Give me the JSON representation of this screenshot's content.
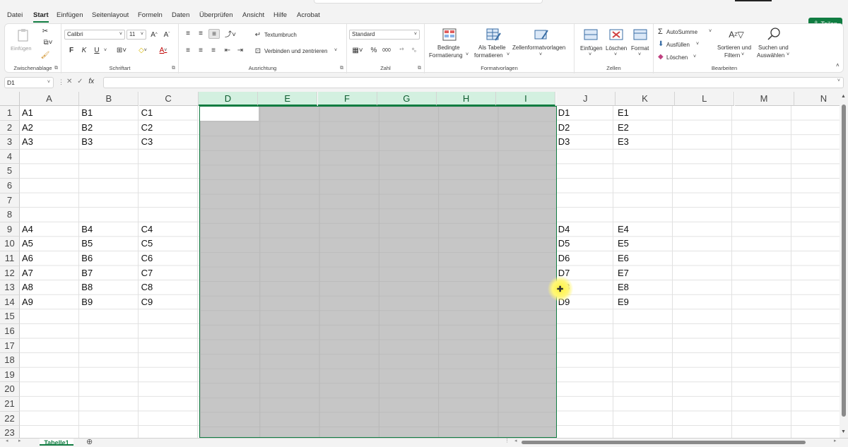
{
  "menu": {
    "tabs": [
      "Datei",
      "Start",
      "Einfügen",
      "Seitenlayout",
      "Formeln",
      "Daten",
      "Überprüfen",
      "Ansicht",
      "Hilfe",
      "Acrobat"
    ],
    "active": "Start",
    "share_label": "Teilen"
  },
  "ribbon": {
    "clipboard": {
      "label": "Zwischenablage",
      "paste": "Einfügen"
    },
    "font": {
      "label": "Schriftart",
      "font_name": "Calibri",
      "font_size": "11",
      "bold": "F",
      "italic": "K",
      "underline": "U"
    },
    "alignment": {
      "label": "Ausrichtung",
      "wrap": "Textumbruch",
      "merge": "Verbinden und zentrieren"
    },
    "number": {
      "label": "Zahl",
      "format": "Standard"
    },
    "styles": {
      "label": "Formatvorlagen",
      "conditional_1": "Bedingte",
      "conditional_2": "Formatierung",
      "table_1": "Als Tabelle",
      "table_2": "formatieren",
      "cell_styles": "Zellenformatvorlagen"
    },
    "cells": {
      "label": "Zellen",
      "insert": "Einfügen",
      "delete": "Löschen",
      "format": "Format"
    },
    "editing": {
      "label": "Bearbeiten",
      "autosum": "AutoSumme",
      "fill": "Ausfüllen",
      "clear": "Löschen",
      "sort_1": "Sortieren und",
      "sort_2": "Filtern",
      "find_1": "Suchen und",
      "find_2": "Auswählen"
    }
  },
  "formula_bar": {
    "name_box": "D1",
    "formula": ""
  },
  "columns": [
    "A",
    "B",
    "C",
    "D",
    "E",
    "F",
    "G",
    "H",
    "I",
    "J",
    "K",
    "L",
    "M",
    "N"
  ],
  "selected_columns": [
    "D",
    "E",
    "F",
    "G",
    "H",
    "I"
  ],
  "rows": [
    "1",
    "2",
    "3",
    "4",
    "5",
    "6",
    "7",
    "8",
    "9",
    "10",
    "11",
    "12",
    "13",
    "14",
    "15",
    "16",
    "17",
    "18",
    "19",
    "20",
    "21",
    "22",
    "23"
  ],
  "cells": {
    "A": [
      "A1",
      "A2",
      "A3",
      "",
      "",
      "",
      "",
      "",
      "A4",
      "A5",
      "A6",
      "A7",
      "A8",
      "A9"
    ],
    "B": [
      "B1",
      "B2",
      "B3",
      "",
      "",
      "",
      "",
      "",
      "B4",
      "B5",
      "B6",
      "B7",
      "B8",
      "B9"
    ],
    "C": [
      "C1",
      "C2",
      "C3",
      "",
      "",
      "",
      "",
      "",
      "C4",
      "C5",
      "C6",
      "C7",
      "C8",
      "C9"
    ],
    "J": [
      "D1",
      "D2",
      "D3",
      "",
      "",
      "",
      "",
      "",
      "D4",
      "D5",
      "D6",
      "D7",
      "D8",
      "D9"
    ],
    "K": [
      "E1",
      "E2",
      "E3",
      "",
      "",
      "",
      "",
      "",
      "E4",
      "E5",
      "E6",
      "E7",
      "E8",
      "E9"
    ]
  },
  "sheet_tabs": [
    "Tabelle1"
  ],
  "icons": [
    "paste-icon",
    "cut-icon",
    "copy-icon",
    "format-painter-icon",
    "increase-font-icon",
    "decrease-font-icon",
    "border-icon",
    "fill-color-icon",
    "font-color-icon",
    "align-icon",
    "wrap-icon",
    "merge-icon",
    "currency-icon",
    "percent-icon",
    "thousands-icon",
    "conditional-format-icon",
    "table-format-icon",
    "cell-styles-icon",
    "insert-cells-icon",
    "delete-cells-icon",
    "format-cells-icon",
    "sum-icon",
    "fill-down-icon",
    "eraser-icon",
    "sort-filter-icon",
    "search-icon",
    "cursor-highlight-icon",
    "share-icon",
    "add-sheet-icon"
  ],
  "accent_color": "#107c41"
}
